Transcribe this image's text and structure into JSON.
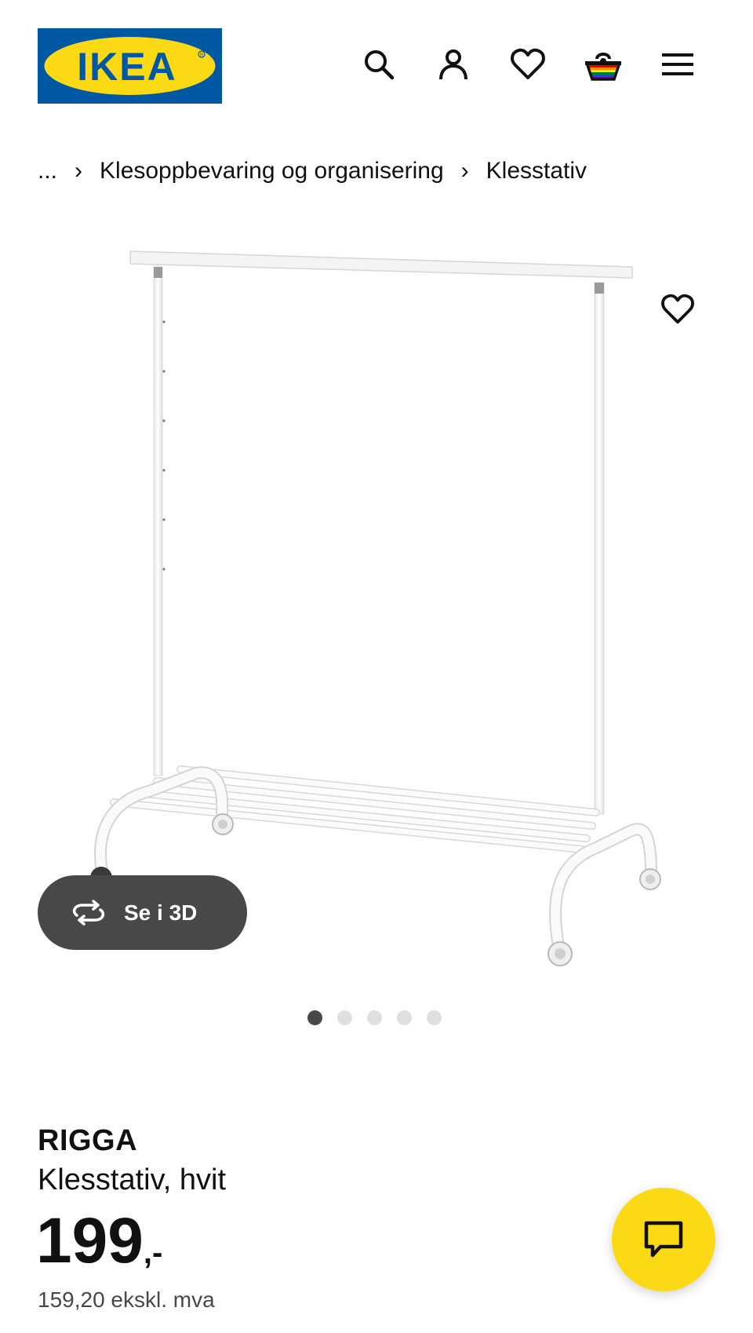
{
  "header": {
    "logo_text": "IKEA",
    "icons": [
      "search-icon",
      "account-icon",
      "heart-icon",
      "basket-icon",
      "menu-icon"
    ]
  },
  "breadcrumb": {
    "ellipsis": "...",
    "separator": "›",
    "items": [
      "Klesoppbevaring og organisering",
      "Klesstativ"
    ]
  },
  "product": {
    "name": "RIGGA",
    "description": "Klesstativ, hvit",
    "price_main": "199",
    "price_suffix": ",-",
    "price_ex_vat": "159,20 ekskl. mva"
  },
  "gallery": {
    "button_3d": "Se i 3D",
    "image_count": 5,
    "active_index": 0
  },
  "colors": {
    "brand_blue": "#0058a3",
    "brand_yellow": "#fbd914",
    "dark_grey": "#484848"
  }
}
